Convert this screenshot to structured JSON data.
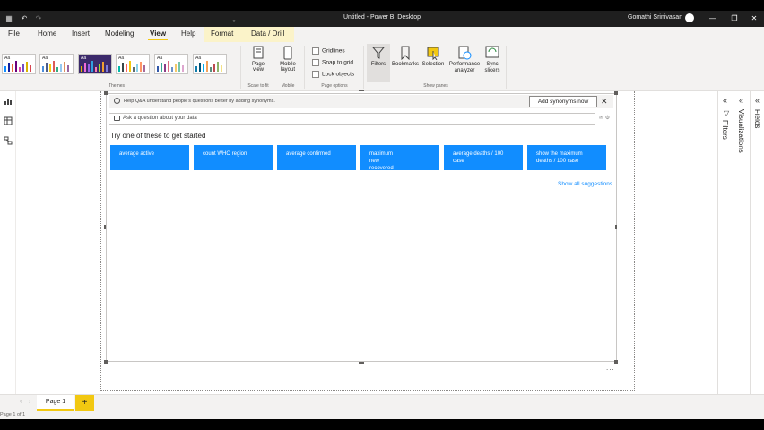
{
  "window": {
    "title": "Untitled - Power BI Desktop",
    "user": "Gomathi Srinivasan"
  },
  "menu": {
    "tabs": [
      "File",
      "Home",
      "Insert",
      "Modeling",
      "View",
      "Help",
      "Format",
      "Data / Drill"
    ],
    "active": "View"
  },
  "ribbon": {
    "themes_label": "Themes",
    "theme_aa": "Aa",
    "scale_to_fit_label": "Scale to fit",
    "page_view_label": "Page view",
    "mobile_label": "Mobile",
    "mobile_layout_label": "Mobile layout",
    "page_options_label": "Page options",
    "gridlines": "Gridlines",
    "snap_to_grid": "Snap to grid",
    "lock_objects": "Lock objects",
    "show_panes_label": "Show panes",
    "filters": "Filters",
    "bookmarks": "Bookmarks",
    "selection": "Selection",
    "performance_analyzer": "Performance analyzer",
    "sync_slicers": "Sync slicers"
  },
  "qa": {
    "banner_text": "Help Q&A understand people's questions better by adding synonyms.",
    "add_synonyms": "Add synonyms now",
    "ask_placeholder": "Ask a question about your data",
    "try_text": "Try one of these to get started",
    "suggestions": [
      "average active",
      "count WHO region",
      "average confirmed",
      "maximum new recovered",
      "average deaths / 100 case",
      "show the maximum deaths / 100 case"
    ],
    "show_all": "Show all suggestions"
  },
  "panes": {
    "filters": "Filters",
    "visualizations": "Visualizations",
    "fields": "Fields"
  },
  "pages": {
    "tab": "Page 1",
    "add": "+",
    "status": "Page 1 of 1"
  },
  "colors": {
    "accent": "#f2c811",
    "suggestion_bg": "#118dff",
    "titlebar": "#1f1f1f"
  }
}
